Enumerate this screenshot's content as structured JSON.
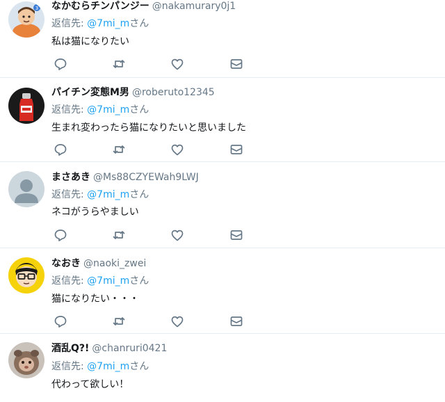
{
  "tweets": [
    {
      "display_name": "なかむらチンパンジー",
      "handle": "@nakamurary0j1",
      "reply_prefix": "返信先: ",
      "reply_to": "@7mi_m",
      "reply_suffix": "さん",
      "text": "私は猫になりたい",
      "avatar": "cartoon-character-avatar"
    },
    {
      "display_name": "パイチン変態M男",
      "handle": "@roberuto12345",
      "reply_prefix": "返信先: ",
      "reply_to": "@7mi_m",
      "reply_suffix": "さん",
      "text": "生まれ変わったら猫になりたいと思いました",
      "avatar": "red-bottle-avatar"
    },
    {
      "display_name": "まさあき",
      "handle": "@Ms88CZYEWah9LWJ",
      "reply_prefix": "返信先: ",
      "reply_to": "@7mi_m",
      "reply_suffix": "さん",
      "text": "ネコがうらやましい",
      "avatar": "default-person-avatar"
    },
    {
      "display_name": "なおき",
      "handle": "@naoki_zwei",
      "reply_prefix": "返信先: ",
      "reply_to": "@7mi_m",
      "reply_suffix": "さん",
      "text": "猫になりたい・・・",
      "avatar": "glasses-face-avatar"
    },
    {
      "display_name": "酒乱Q?!",
      "handle": "@chanruri0421",
      "reply_prefix": "返信先: ",
      "reply_to": "@7mi_m",
      "reply_suffix": "さん",
      "text": "代わって欲しい！",
      "avatar": "photo-avatar"
    }
  ],
  "actions": [
    "reply-icon",
    "retweet-icon",
    "like-icon",
    "direct-message-icon"
  ],
  "colors": {
    "link": "#1da1f2",
    "secondary_text": "#657786",
    "primary_text": "#14171a",
    "divider": "#e6ecf0"
  }
}
